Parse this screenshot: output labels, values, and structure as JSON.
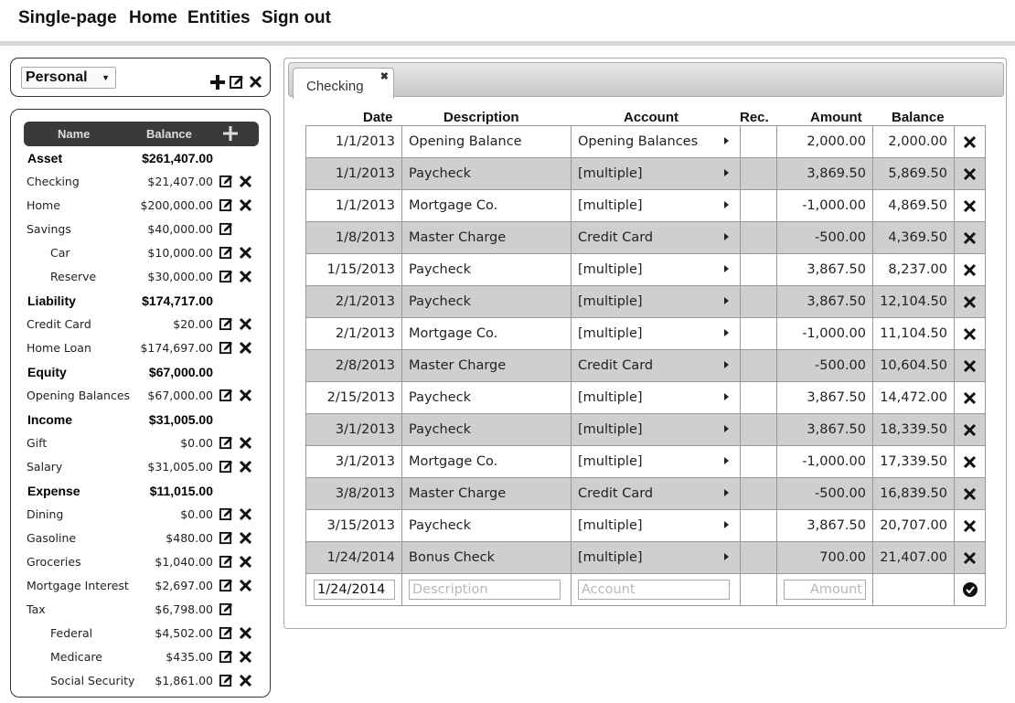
{
  "nav": {
    "items": [
      "Single-page",
      "Home",
      "Entities",
      "Sign out"
    ]
  },
  "entity": {
    "selected": "Personal"
  },
  "accounts": {
    "header": {
      "name": "Name",
      "balance": "Balance"
    },
    "rows": [
      {
        "name": "Asset",
        "balance": "$261,407.00",
        "group": true
      },
      {
        "name": "Checking",
        "balance": "$21,407.00"
      },
      {
        "name": "Home",
        "balance": "$200,000.00"
      },
      {
        "name": "Savings",
        "balance": "$40,000.00"
      },
      {
        "name": "Car",
        "balance": "$10,000.00"
      },
      {
        "name": "Reserve",
        "balance": "$30,000.00"
      },
      {
        "name": "Liability",
        "balance": "$174,717.00",
        "group": true
      },
      {
        "name": "Credit Card",
        "balance": "$20.00"
      },
      {
        "name": "Home Loan",
        "balance": "$174,697.00"
      },
      {
        "name": "Equity",
        "balance": "$67,000.00",
        "group": true
      },
      {
        "name": "Opening Balances",
        "balance": "$67,000.00"
      },
      {
        "name": "Income",
        "balance": "$31,005.00",
        "group": true
      },
      {
        "name": "Gift",
        "balance": "$0.00"
      },
      {
        "name": "Salary",
        "balance": "$31,005.00"
      },
      {
        "name": "Expense",
        "balance": "$11,015.00",
        "group": true
      },
      {
        "name": "Dining",
        "balance": "$0.00"
      },
      {
        "name": "Gasoline",
        "balance": "$480.00"
      },
      {
        "name": "Groceries",
        "balance": "$1,040.00"
      },
      {
        "name": "Mortgage Interest",
        "balance": "$2,697.00"
      },
      {
        "name": "Tax",
        "balance": "$6,798.00"
      },
      {
        "name": "Federal",
        "balance": "$4,502.00"
      },
      {
        "name": "Medicare",
        "balance": "$435.00"
      },
      {
        "name": "Social Security",
        "balance": "$1,861.00"
      }
    ]
  },
  "register": {
    "tab": "Checking",
    "columns": {
      "date": "Date",
      "description": "Description",
      "account": "Account",
      "rec": "Rec.",
      "amount": "Amount",
      "balance": "Balance"
    },
    "rows": [
      {
        "date": "1/1/2013",
        "description": "Opening Balance",
        "account": "Opening Balances",
        "amount": "2,000.00",
        "balance": "2,000.00"
      },
      {
        "date": "1/1/2013",
        "description": "Paycheck",
        "account": "[multiple]",
        "amount": "3,869.50",
        "balance": "5,869.50"
      },
      {
        "date": "1/1/2013",
        "description": "Mortgage Co.",
        "account": "[multiple]",
        "amount": "-1,000.00",
        "balance": "4,869.50"
      },
      {
        "date": "1/8/2013",
        "description": "Master Charge",
        "account": "Credit Card",
        "amount": "-500.00",
        "balance": "4,369.50"
      },
      {
        "date": "1/15/2013",
        "description": "Paycheck",
        "account": "[multiple]",
        "amount": "3,867.50",
        "balance": "8,237.00"
      },
      {
        "date": "2/1/2013",
        "description": "Paycheck",
        "account": "[multiple]",
        "amount": "3,867.50",
        "balance": "12,104.50"
      },
      {
        "date": "2/1/2013",
        "description": "Mortgage Co.",
        "account": "[multiple]",
        "amount": "-1,000.00",
        "balance": "11,104.50"
      },
      {
        "date": "2/8/2013",
        "description": "Master Charge",
        "account": "Credit Card",
        "amount": "-500.00",
        "balance": "10,604.50"
      },
      {
        "date": "2/15/2013",
        "description": "Paycheck",
        "account": "[multiple]",
        "amount": "3,867.50",
        "balance": "14,472.00"
      },
      {
        "date": "3/1/2013",
        "description": "Paycheck",
        "account": "[multiple]",
        "amount": "3,867.50",
        "balance": "18,339.50"
      },
      {
        "date": "3/1/2013",
        "description": "Mortgage Co.",
        "account": "[multiple]",
        "amount": "-1,000.00",
        "balance": "17,339.50"
      },
      {
        "date": "3/8/2013",
        "description": "Master Charge",
        "account": "Credit Card",
        "amount": "-500.00",
        "balance": "16,839.50"
      },
      {
        "date": "3/15/2013",
        "description": "Paycheck",
        "account": "[multiple]",
        "amount": "3,867.50",
        "balance": "20,707.00"
      },
      {
        "date": "1/24/2014",
        "description": "Bonus Check",
        "account": "[multiple]",
        "amount": "700.00",
        "balance": "21,407.00"
      }
    ],
    "new_entry": {
      "date_value": "1/24/2014",
      "description_placeholder": "Description",
      "account_placeholder": "Account",
      "amount_placeholder": "Amount"
    }
  }
}
